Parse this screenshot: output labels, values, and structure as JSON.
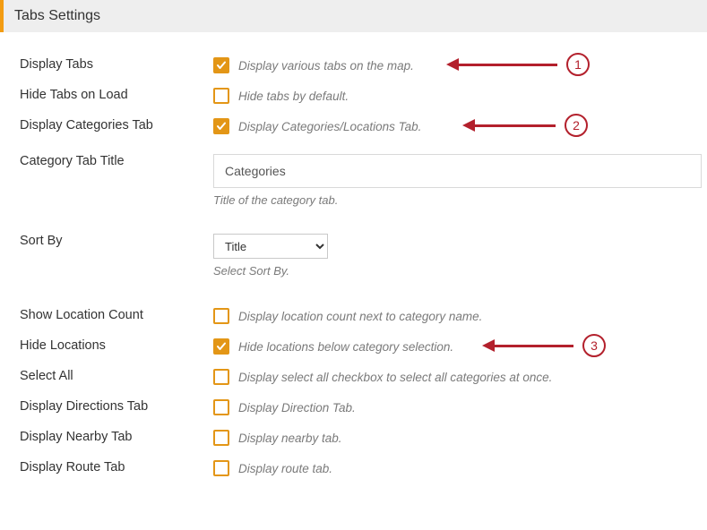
{
  "section_title": "Tabs Settings",
  "rows": {
    "display_tabs": {
      "label": "Display Tabs",
      "checked": true,
      "desc": "Display various tabs on the map."
    },
    "hide_tabs_on_load": {
      "label": "Hide Tabs on Load",
      "checked": false,
      "desc": "Hide tabs by default."
    },
    "display_categories_tab": {
      "label": "Display Categories Tab",
      "checked": true,
      "desc": "Display Categories/Locations Tab."
    },
    "category_tab_title": {
      "label": "Category Tab Title",
      "value": "Categories",
      "help": "Title of the category tab."
    },
    "sort_by": {
      "label": "Sort By",
      "value": "Title",
      "help": "Select Sort By."
    },
    "show_location_count": {
      "label": "Show Location Count",
      "checked": false,
      "desc": "Display location count next to category name."
    },
    "hide_locations": {
      "label": "Hide Locations",
      "checked": true,
      "desc": "Hide locations below category selection."
    },
    "select_all": {
      "label": "Select All",
      "checked": false,
      "desc": "Display select all checkbox to select all categories at once."
    },
    "display_directions_tab": {
      "label": "Display Directions Tab",
      "checked": false,
      "desc": "Display Direction Tab."
    },
    "display_nearby_tab": {
      "label": "Display Nearby Tab",
      "checked": false,
      "desc": "Display nearby tab."
    },
    "display_route_tab": {
      "label": "Display Route Tab",
      "checked": false,
      "desc": "Display route tab."
    }
  },
  "annotations": {
    "a1": "1",
    "a2": "2",
    "a3": "3"
  },
  "colors": {
    "accent": "#e39616",
    "callout": "#b3202c",
    "header_bg": "#eeeeee"
  }
}
